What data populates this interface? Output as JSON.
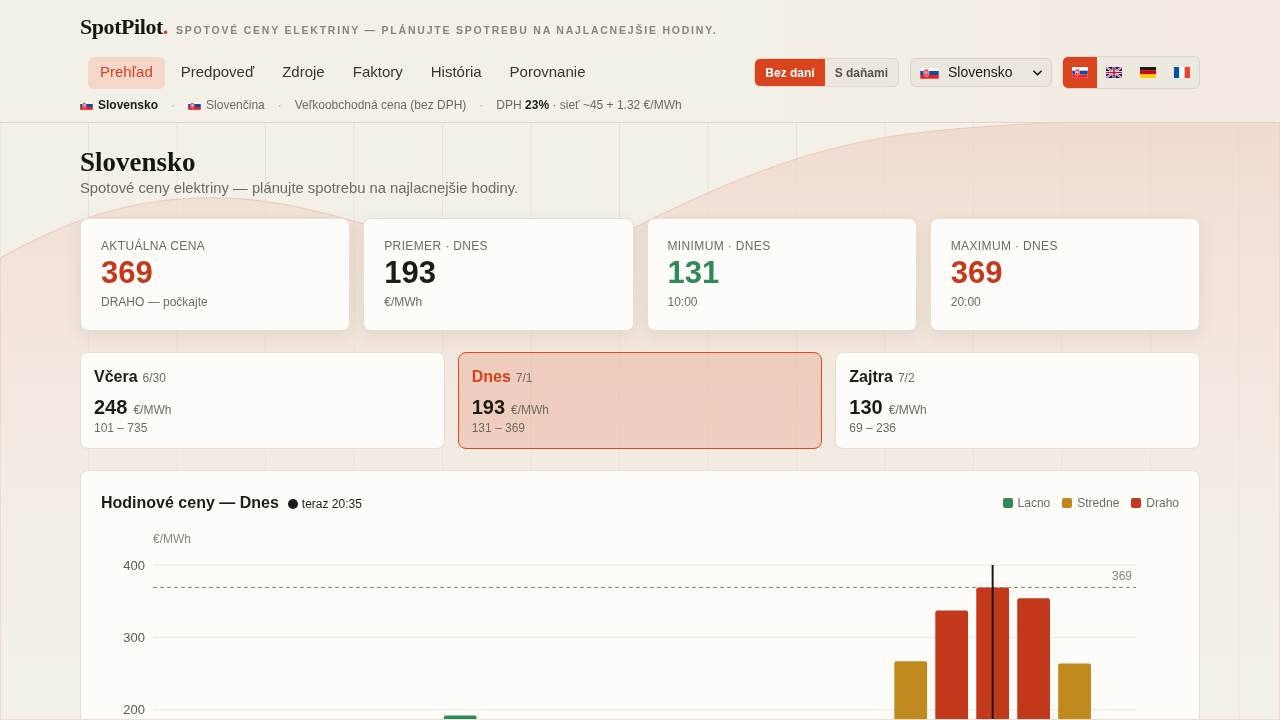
{
  "header": {
    "logo": {
      "name": "SpotPilot",
      "dot": "."
    },
    "tagline": "SPOTOVÉ CENY ELEKTRINY — PLÁNUJTE SPOTREBU NA NAJLACNEJŠIE HODINY."
  },
  "nav": {
    "tabs": [
      {
        "label": "Prehľad",
        "selected": true
      },
      {
        "label": "Predpoveď",
        "selected": false
      },
      {
        "label": "Zdroje",
        "selected": false
      },
      {
        "label": "Faktory",
        "selected": false
      },
      {
        "label": "História",
        "selected": false
      },
      {
        "label": "Porovnanie",
        "selected": false
      }
    ]
  },
  "tax_toggle": [
    {
      "label": "Bez daní",
      "selected": true
    },
    {
      "label": "S daňami",
      "selected": false
    }
  ],
  "country_select": {
    "value": "Slovensko"
  },
  "languages": [
    {
      "kind": "slovak",
      "selected": true
    },
    {
      "kind": "british",
      "selected": false
    },
    {
      "kind": "german",
      "selected": false
    },
    {
      "kind": "french",
      "selected": false
    }
  ],
  "info_bar": [
    {
      "kind": "country",
      "text": "Slovensko"
    },
    {
      "kind": "separator",
      "text": "·"
    },
    {
      "kind": "language",
      "text": "Slovenčina"
    },
    {
      "kind": "separator",
      "text": "·"
    },
    {
      "kind": "plain",
      "text": "Veľkoobchodná cena (bez DPH)"
    },
    {
      "kind": "separator",
      "text": "·"
    },
    {
      "kind": "plain",
      "text": "DPH **23%** · sieť ~45 + 1.32 €/MWh"
    }
  ],
  "page": {
    "title": "Slovensko",
    "subtitle": "Spotové ceny elektriny — plánujte spotrebu na najlacnejšie hodiny."
  },
  "stats": [
    {
      "label": "AKTUÁLNA CENA",
      "value": "369",
      "color": "#c2391b",
      "note": "DRAHO — počkajte"
    },
    {
      "label": "PRIEMER · DNES",
      "value": "193",
      "color": "#1f1b16",
      "note": "€/MWh"
    },
    {
      "label": "MINIMUM · DNES",
      "value": "131",
      "color": "#2e8a5a",
      "note": "10:00"
    },
    {
      "label": "MAXIMUM · DNES",
      "value": "369",
      "color": "#c2391b",
      "note": "20:00"
    }
  ],
  "days": [
    {
      "name": "Včera",
      "date": "6/30",
      "value": "248",
      "unit": "€/MWh",
      "range": "101 – 735",
      "selected": false
    },
    {
      "name": "Dnes",
      "date": "7/1",
      "value": "193",
      "unit": "€/MWh",
      "range": "131 – 369",
      "selected": true
    },
    {
      "name": "Zajtra",
      "date": "7/2",
      "value": "130",
      "unit": "€/MWh",
      "range": "69 – 236",
      "selected": false
    }
  ],
  "chart": {
    "title": "Hodinové ceny — Dnes",
    "now": "teraz 20:35",
    "chart_data": {
      "type": "bar",
      "ylabel": "€/MWh",
      "ylim": [
        187,
        400
      ],
      "yticks": [
        200,
        300,
        400
      ],
      "series": [
        {
          "name": "Lacno",
          "color": "#2e8a5a",
          "values": [
            null,
            null,
            null,
            null,
            null,
            null,
            null,
            192,
            null,
            null,
            null,
            null,
            null,
            null,
            null,
            null,
            null,
            null,
            null,
            null,
            null,
            null,
            null,
            null
          ]
        },
        {
          "name": "Stredne",
          "color": "#c0891e",
          "values": [
            null,
            null,
            null,
            null,
            null,
            null,
            null,
            null,
            null,
            null,
            null,
            null,
            null,
            null,
            null,
            null,
            null,
            null,
            267,
            null,
            null,
            null,
            264,
            null
          ]
        },
        {
          "name": "Draho",
          "color": "#c2381b",
          "values": [
            null,
            null,
            null,
            null,
            null,
            null,
            null,
            null,
            null,
            null,
            null,
            null,
            null,
            null,
            null,
            null,
            null,
            null,
            null,
            337,
            369,
            354,
            null,
            null
          ]
        }
      ],
      "ref_lines": [
        {
          "axis": "y",
          "value": 369,
          "label": "369"
        }
      ]
    }
  }
}
